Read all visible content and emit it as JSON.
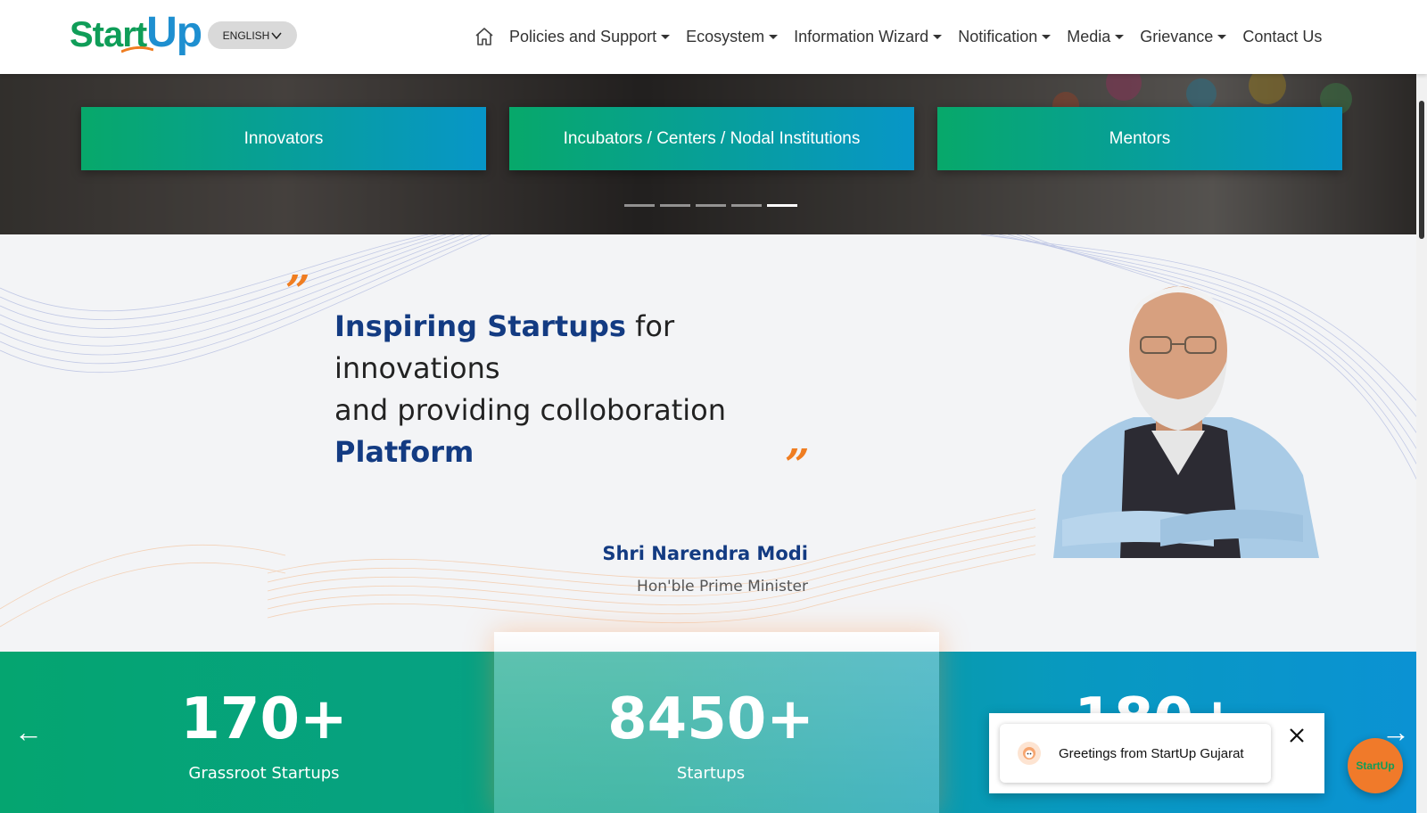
{
  "header": {
    "logo": {
      "part1": "Start",
      "part2": "Up"
    },
    "language": {
      "label": "ENGLISH"
    },
    "nav": {
      "home_icon": "home-icon",
      "items": [
        {
          "label": "Policies and Support",
          "dropdown": true
        },
        {
          "label": "Ecosystem",
          "dropdown": true
        },
        {
          "label": "Information Wizard",
          "dropdown": true
        },
        {
          "label": "Notification",
          "dropdown": true
        },
        {
          "label": "Media",
          "dropdown": true
        },
        {
          "label": "Grievance",
          "dropdown": true
        },
        {
          "label": "Contact Us",
          "dropdown": false
        }
      ]
    }
  },
  "hero": {
    "buttons": [
      {
        "label": "Innovators"
      },
      {
        "label": "Incubators / Centers / Nodal Institutions"
      },
      {
        "label": "Mentors"
      }
    ],
    "indicators": {
      "count": 5,
      "active_index": 4
    }
  },
  "quote": {
    "open_mark": "”",
    "close_mark": "”",
    "line1_highlight": "Inspiring Startups",
    "line1_rest": " for",
    "line2": "innovations",
    "line3": "and providing colloboration",
    "line4_highlight": "Platform",
    "speaker_name": "Shri Narendra Modi",
    "speaker_role": "Hon'ble Prime Minister"
  },
  "stats": {
    "prev_icon": "←",
    "next_icon": "→",
    "items": [
      {
        "value": "170+",
        "label": "Grassroot Startups"
      },
      {
        "value": "8450+",
        "label": "Startups"
      },
      {
        "value": "180+",
        "label": ""
      }
    ]
  },
  "chat": {
    "greeting": "Greetings from StartUp Gujarat",
    "fab_label": "StartUp"
  },
  "colors": {
    "brand_green": "#0f9d58",
    "brand_blue": "#1e8fd0",
    "accent_orange": "#ef7d21",
    "heading_navy": "#133b82"
  }
}
